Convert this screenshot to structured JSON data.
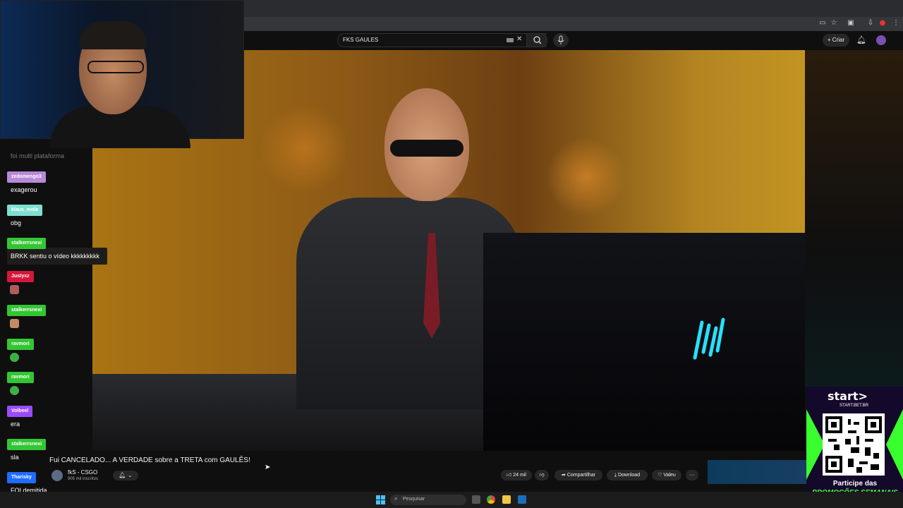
{
  "youtube": {
    "search": {
      "value": "FKS GAULES"
    },
    "header": {
      "create_label": "Criar"
    },
    "video": {
      "title": "Fui CANCELADO... A VERDADE sobre a TRETA com GAULÊS!",
      "channel_name": "fkS - CSGO",
      "subscribers": "905 mil inscritos",
      "likes": "24 mil",
      "share_label": "Compartilhar",
      "download_label": "Download",
      "thanks_label": "Valeu",
      "more_label": "···"
    }
  },
  "chat": {
    "faded_message": "foi multi plataforma",
    "messages": [
      {
        "user": "zedomengo3",
        "text": "exagerou",
        "color": "#b889d8"
      },
      {
        "user": "klaus_mola",
        "text": "obg",
        "color": "#7fe0d2"
      },
      {
        "user": "stalkerrsnexi",
        "text": "BRKK sentiu o vídeo kkkkkkkkk",
        "color": "#33c633"
      },
      {
        "user": "Justyxz",
        "text": "",
        "color": "#d6163a"
      },
      {
        "user": "stalkerrsnexi",
        "text": "",
        "color": "#33c633"
      },
      {
        "user": "ravmori",
        "text": "",
        "color": "#33c633"
      },
      {
        "user": "ravmori",
        "text": "",
        "color": "#33c633"
      },
      {
        "user": "Volbeel",
        "text": "era",
        "color": "#9b4bff"
      },
      {
        "user": "stalkerrsnexi",
        "text": "sla",
        "color": "#33c633"
      },
      {
        "user": "Tharisky",
        "text": "FOI demitida",
        "color": "#1f6cff"
      }
    ]
  },
  "ad": {
    "brand": "start>",
    "site": "START.BET.BR",
    "line1": "Participe das",
    "line2": "PROMOÇÕES SEMANAIS"
  },
  "taskbar": {
    "search_placeholder": "Pesquisar"
  }
}
